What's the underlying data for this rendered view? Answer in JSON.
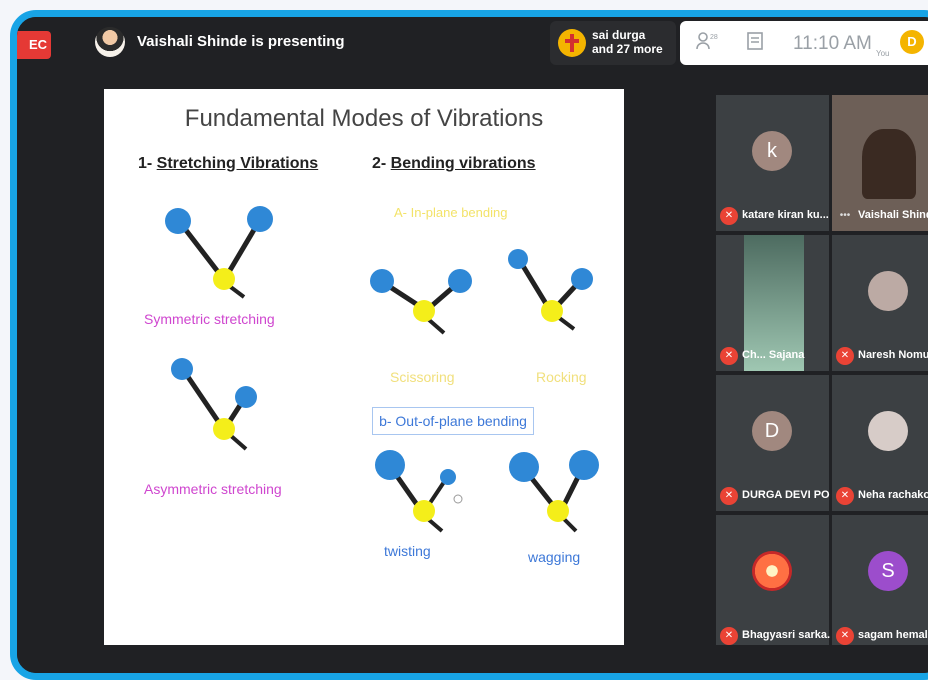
{
  "topbar": {
    "rec_label": "EC",
    "presenter_text": "Vaishali Shinde is presenting",
    "attendees": {
      "line1": "sai durga",
      "line2": "and 27 more"
    },
    "controls": {
      "time": "11:10 AM",
      "you_label": "You",
      "you_initial": "D"
    }
  },
  "slide": {
    "title": "Fundamental Modes of Vibrations",
    "stretching_heading": {
      "num": "1- ",
      "text": "Stretching Vibrations"
    },
    "bending_heading": {
      "num": "2- ",
      "text": "Bending vibrations"
    },
    "in_plane": "A- In-plane bending",
    "symmetric": "Symmetric stretching",
    "asymmetric": "Asymmetric stretching",
    "scissoring": "Scissoring",
    "rocking": "Rocking",
    "out_of_plane": "b- Out-of-plane bending",
    "twisting": "twisting",
    "wagging": "wagging"
  },
  "participants": [
    {
      "name": "katare kiran ku...",
      "initial": "k",
      "avatar_color": "#a1887f"
    },
    {
      "name": "Vaishali Shinde",
      "initial": "",
      "avatar_color": "#8d6e63"
    },
    {
      "name": "Ch... Sajana",
      "initial": "",
      "avatar_color": "#80cbc4"
    },
    {
      "name": "Naresh Nomula",
      "initial": "",
      "avatar_color": "#bcaaa4"
    },
    {
      "name": "DURGA DEVI PO...",
      "initial": "D",
      "avatar_color": "#a1887f"
    },
    {
      "name": "Neha rachakonda",
      "initial": "",
      "avatar_color": "#d7ccc8"
    },
    {
      "name": "Bhagyasri sarka...",
      "initial": "",
      "avatar_color": "#ff7043"
    },
    {
      "name": "sagam hemalatha",
      "initial": "S",
      "avatar_color": "#9c4dcc"
    }
  ],
  "colors": {
    "accent_border": "#18a4e6",
    "mic_off": "#ea4335",
    "rec": "#e53935"
  }
}
